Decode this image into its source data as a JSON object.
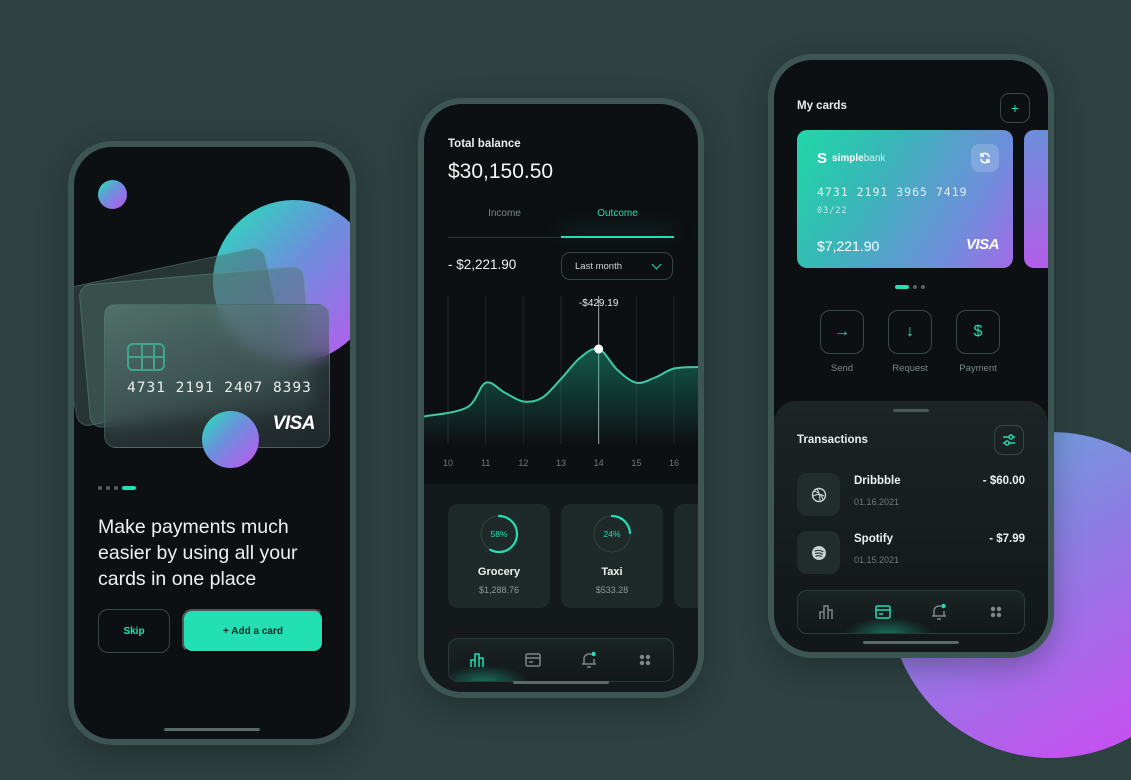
{
  "colors": {
    "background": "#2d4140",
    "accent": "#22e0b4",
    "screen": "#0d1013",
    "orb_start": "#21e6b6",
    "orb_end": "#c353f0"
  },
  "onboarding": {
    "card_number": "4731 2191 2407 8393",
    "card_brand": "VISA",
    "pager": {
      "count": 4,
      "active": 3
    },
    "headline": "Make payments much easier by using all your cards in one place",
    "skip_label": "Skip",
    "add_card_label": "+ Add a card"
  },
  "dashboard": {
    "total_label": "Total balance",
    "total_value": "$30,150.50",
    "tabs": [
      {
        "label": "Income",
        "active": false
      },
      {
        "label": "Outcome",
        "active": true
      }
    ],
    "outcome_value": "- $2,221.90",
    "period_select": "Last month",
    "chart_data": {
      "type": "line",
      "x": [
        10,
        10.5,
        11,
        11.5,
        12,
        12.5,
        13,
        13.5,
        14,
        14.5,
        15,
        15.5,
        16,
        16.5
      ],
      "y": [
        0.1,
        0.22,
        0.55,
        0.42,
        0.3,
        0.35,
        0.6,
        0.88,
        1.0,
        0.72,
        0.55,
        0.62,
        0.74,
        0.76
      ],
      "tick_labels": [
        "10",
        "11",
        "12",
        "13",
        "14",
        "15",
        "16"
      ],
      "highlight": {
        "x": 14,
        "label": "-$429.19"
      },
      "xlabel": "",
      "ylabel": ""
    },
    "categories": [
      {
        "name": "Grocery",
        "amount": "$1,288.76",
        "percent": 58,
        "percent_label": "58%"
      },
      {
        "name": "Taxi",
        "amount": "$533.28",
        "percent": 24,
        "percent_label": "24%"
      }
    ],
    "nav": [
      {
        "icon": "stats-icon",
        "active": true
      },
      {
        "icon": "card-icon",
        "active": false
      },
      {
        "icon": "bell-icon",
        "active": false
      },
      {
        "icon": "grid-icon",
        "active": false
      }
    ]
  },
  "cards": {
    "title": "My cards",
    "add_label": "+",
    "bank_name_bold": "simple",
    "bank_name_light": "bank",
    "card_number": "4731 2191 3965 7419",
    "expiry": "03/22",
    "balance": "$7,221.90",
    "card_brand": "VISA",
    "pager": {
      "count": 3,
      "active": 0
    },
    "actions": [
      {
        "label": "Send",
        "icon": "arrow-right-icon",
        "glyph": "→"
      },
      {
        "label": "Request",
        "icon": "arrow-down-icon",
        "glyph": "↓"
      },
      {
        "label": "Payment",
        "icon": "dollar-icon",
        "glyph": "$"
      }
    ],
    "transactions_title": "Transactions",
    "transactions": [
      {
        "name": "Dribbble",
        "date": "01.16.2021",
        "amount": "- $60.00",
        "icon": "dribbble-icon"
      },
      {
        "name": "Spotify",
        "date": "01.15.2021",
        "amount": "- $7.99",
        "icon": "spotify-icon"
      }
    ],
    "nav": [
      {
        "icon": "stats-icon",
        "active": false
      },
      {
        "icon": "card-icon",
        "active": true
      },
      {
        "icon": "bell-icon",
        "active": false
      },
      {
        "icon": "grid-icon",
        "active": false
      }
    ]
  }
}
